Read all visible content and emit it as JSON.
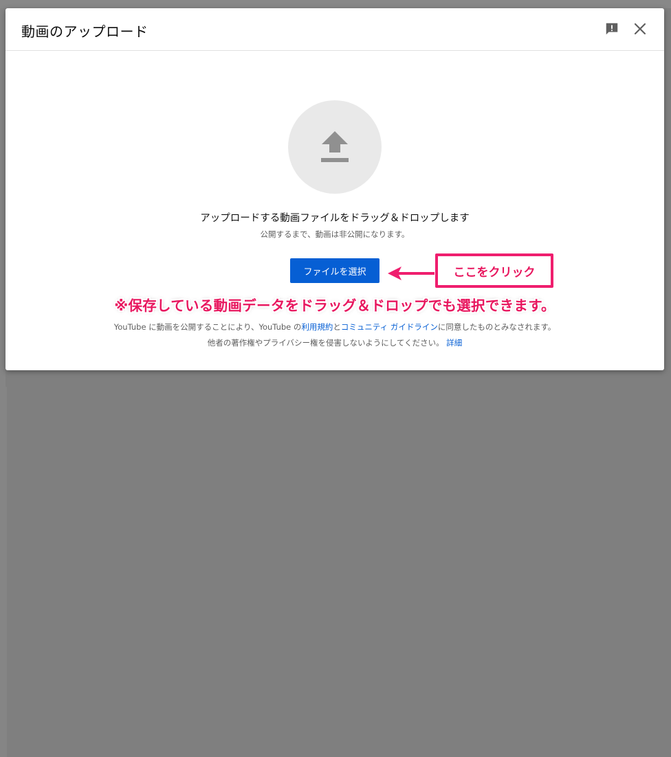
{
  "dialog": {
    "title": "動画のアップロード",
    "feedback_icon": "feedback-icon",
    "close_icon": "close-icon"
  },
  "upload": {
    "icon": "upload-arrow-icon",
    "main_text": "アップロードする動画ファイルをドラッグ＆ドロップします",
    "sub_text": "公開するまで、動画は非公開になります。",
    "select_button_label": "ファイルを選択"
  },
  "annotation": {
    "callout": "ここをクリック",
    "note": "※保存している動画データをドラッグ＆ドロップでも選択できます。"
  },
  "terms": {
    "line1_prefix": "YouTube に動画を公開することにより、YouTube の",
    "terms_link": "利用規約",
    "and": "と",
    "guidelines_link": "コミュニティ ガイドライン",
    "line1_suffix": "に同意したものとみなされます。",
    "line2_text": "他者の著作権やプライバシー権を侵害しないようにしてください。",
    "details_link": "詳細"
  },
  "colors": {
    "accent": "#065fd4",
    "annotation_pink": "#e8175f"
  }
}
